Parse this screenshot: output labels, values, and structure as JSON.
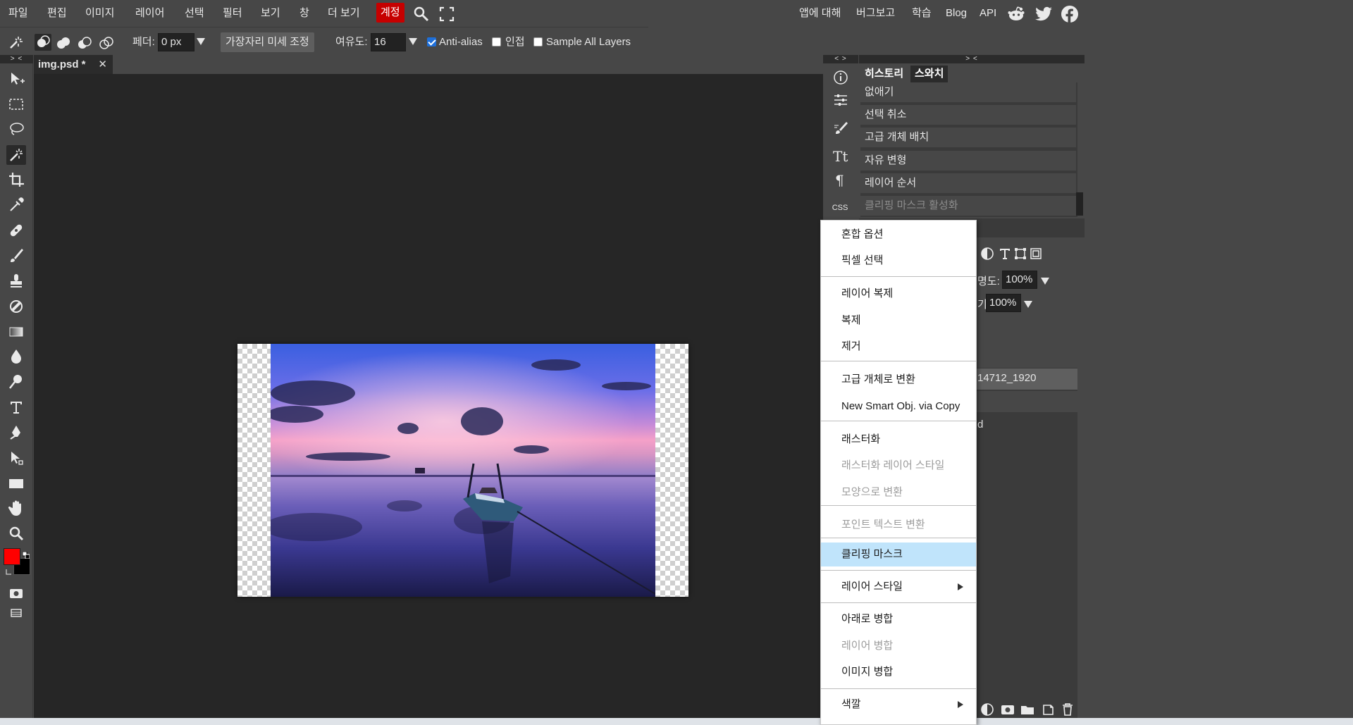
{
  "menubar": {
    "items": [
      "파일",
      "편집",
      "이미지",
      "레이어",
      "선택",
      "필터",
      "보기",
      "창",
      "더 보기"
    ],
    "account": "계정",
    "links": [
      "앱에 대해",
      "버그보고",
      "학습",
      "Blog",
      "API"
    ],
    "social_icons": [
      "reddit-icon",
      "twitter-icon",
      "facebook-icon"
    ]
  },
  "options": {
    "feather_label": "페더:",
    "feather_value": "0 px",
    "refine_edge": "가장자리 미세 조정",
    "tolerance_label": "여유도:",
    "tolerance_value": "16",
    "anti_alias": "Anti-alias",
    "anti_alias_checked": true,
    "contiguous": "인접",
    "contiguous_checked": false,
    "sample_all": "Sample All Layers",
    "sample_all_checked": false
  },
  "document": {
    "tab_title": "img.psd *",
    "close": "✕"
  },
  "collapse": {
    "left": "> <",
    "side": "< >",
    "right": "> <"
  },
  "panels": {
    "tabs": [
      "히스토리",
      "스와치"
    ],
    "history": [
      "없애기",
      "선택 취소",
      "고급 개체 배치",
      "자유 변형",
      "레이어 순서",
      "클리핑 마스크 활성화"
    ],
    "side_css": "CSS"
  },
  "layers": {
    "opacity_label_partial": "명도:",
    "opacity_value": "100%",
    "fill_label_partial": "기:",
    "fill_value": "100%",
    "layer_name_partial": "14712_1920",
    "layer2_partial": "d"
  },
  "context_menu": {
    "items": [
      {
        "label": "혼합 옵션",
        "disabled": false
      },
      {
        "label": "픽셀 선택",
        "disabled": false
      },
      {
        "label": "레이어 복제",
        "disabled": false
      },
      {
        "label": "복제",
        "disabled": false
      },
      {
        "label": "제거",
        "disabled": false
      },
      {
        "label": "고급 개체로 변환",
        "disabled": false
      },
      {
        "label": "New Smart Obj. via Copy",
        "disabled": false
      },
      {
        "label": "래스터화",
        "disabled": false
      },
      {
        "label": "래스터화 레이어 스타일",
        "disabled": true
      },
      {
        "label": "모양으로 변환",
        "disabled": true
      },
      {
        "label": "포인트 텍스트 변환",
        "disabled": true
      },
      {
        "label": "클리핑 마스크",
        "disabled": false,
        "highlighted": true
      },
      {
        "label": "레이어 스타일",
        "disabled": false,
        "submenu": true
      },
      {
        "label": "아래로 병합",
        "disabled": false
      },
      {
        "label": "레이어 병합",
        "disabled": true
      },
      {
        "label": "이미지 병합",
        "disabled": false
      },
      {
        "label": "색깔",
        "disabled": false,
        "submenu": true
      }
    ]
  },
  "colors": {
    "foreground": "#ff0000",
    "background": "#000000",
    "account_bg": "#c60000",
    "menu_highlight": "#c0e4fb"
  }
}
